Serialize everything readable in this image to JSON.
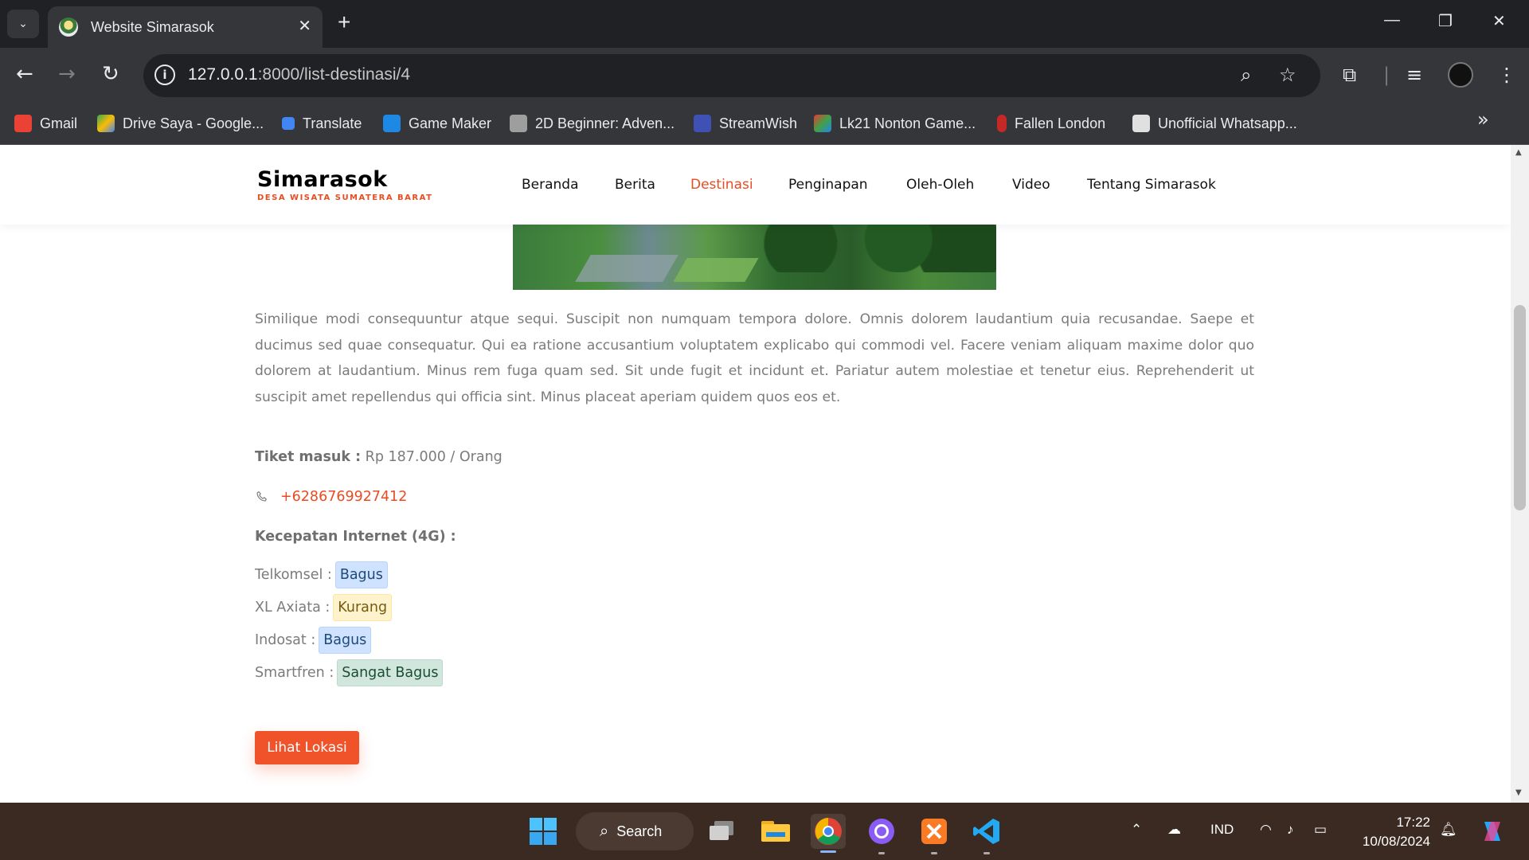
{
  "browser": {
    "tab_title": "Website Simarasok",
    "url_host": "127.0.0.1",
    "url_path": ":8000/list-destinasi/4",
    "bookmarks": [
      {
        "label": "Gmail",
        "color": "#ea4335"
      },
      {
        "label": "Drive Saya - Google...",
        "color": "#fbbc04"
      },
      {
        "label": "Translate",
        "color": "#4285f4"
      },
      {
        "label": "Game Maker",
        "color": "#1e88e5"
      },
      {
        "label": "2D Beginner: Adven...",
        "color": "#9e9e9e"
      },
      {
        "label": "StreamWish",
        "color": "#3f51b5"
      },
      {
        "label": "Lk21 Nonton Game...",
        "color": "#e53935"
      },
      {
        "label": "Fallen London",
        "color": "#c62828"
      },
      {
        "label": "Unofficial Whatsapp...",
        "color": "#e0e0e0"
      }
    ]
  },
  "site": {
    "logo_title": "Simarasok",
    "logo_subtitle": "DESA WISATA SUMATERA BARAT",
    "accent_color": "#e84c22",
    "menu": [
      "Beranda",
      "Berita",
      "Destinasi",
      "Penginapan",
      "Oleh-Oleh",
      "Video",
      "Tentang Simarasok"
    ],
    "active_menu": "Destinasi"
  },
  "content": {
    "description": "Similique modi consequuntur atque sequi. Suscipit non numquam tempora dolore. Omnis dolorem laudantium quia recusandae. Saepe et ducimus sed quae consequatur. Qui ea ratione accusantium voluptatem explicabo qui commodi vel. Facere veniam aliquam maxime dolor quo dolorem at laudantium. Minus rem fuga quam sed. Sit unde fugit et incidunt et. Pariatur autem molestiae et tenetur eius. Reprehenderit ut suscipit amet repellendus qui officia sint. Minus placeat aperiam quidem quos eos et.",
    "ticket_label": "Tiket masuk :",
    "ticket_value": "Rp 187.000 / Orang",
    "phone": "+6286769927412",
    "speed_title": "Kecepatan Internet (4G) :",
    "providers": [
      {
        "name": "Telkomsel :",
        "status": "Bagus",
        "level": "good"
      },
      {
        "name": "XL Axiata :",
        "status": "Kurang",
        "level": "low"
      },
      {
        "name": "Indosat :",
        "status": "Bagus",
        "level": "good"
      },
      {
        "name": "Smartfren :",
        "status": "Sangat Bagus",
        "level": "great"
      }
    ],
    "location_button": "Lihat Lokasi"
  },
  "taskbar": {
    "search_label": "Search",
    "language": "IND",
    "time": "17:22",
    "date": "10/08/2024"
  }
}
